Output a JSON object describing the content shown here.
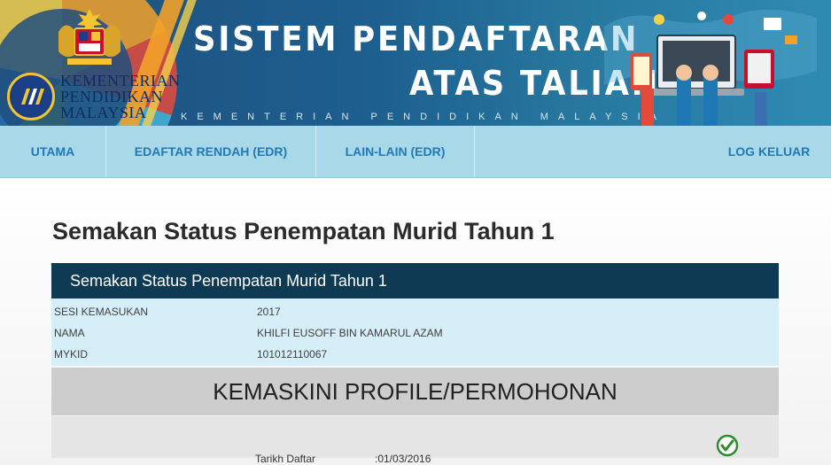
{
  "banner": {
    "title_line1": "SISTEM PENDAFTARAN",
    "title_line2": "ATAS TALIAN",
    "subtitle": "KEMENTERIAN PENDIDIKAN MALAYSIA",
    "ministry_line1": "KEMENTERIAN",
    "ministry_line2": "PENDIDIKAN",
    "ministry_line3": "MALAYSIA"
  },
  "nav": {
    "items": [
      {
        "label": "UTAMA"
      },
      {
        "label": "EDAFTAR RENDAH (EDR)"
      },
      {
        "label": "LAIN-LAIN (EDR)"
      }
    ],
    "logout": "LOG KELUAR"
  },
  "page": {
    "title": "Semakan Status Penempatan Murid Tahun 1",
    "panel_title": "Semakan Status Penempatan Murid Tahun 1"
  },
  "info": {
    "rows": [
      {
        "label": "SESI KEMASUKAN",
        "value": "2017"
      },
      {
        "label": "NAMA",
        "value": "KHILFI EUSOFF BIN KAMARUL AZAM"
      },
      {
        "label": "MYKID",
        "value": "101012110067"
      }
    ]
  },
  "section": {
    "title": "KEMASKINI PROFILE/PERMOHONAN",
    "tarikh_label": "Tarikh Daftar",
    "tarikh_value": ":01/03/2016"
  },
  "colors": {
    "nav_bg": "#a9d8e9",
    "nav_text": "#1e7ab8",
    "panel_head": "#0f3a53",
    "info_bg": "#d6eef8",
    "check": "#2e8b2e"
  }
}
